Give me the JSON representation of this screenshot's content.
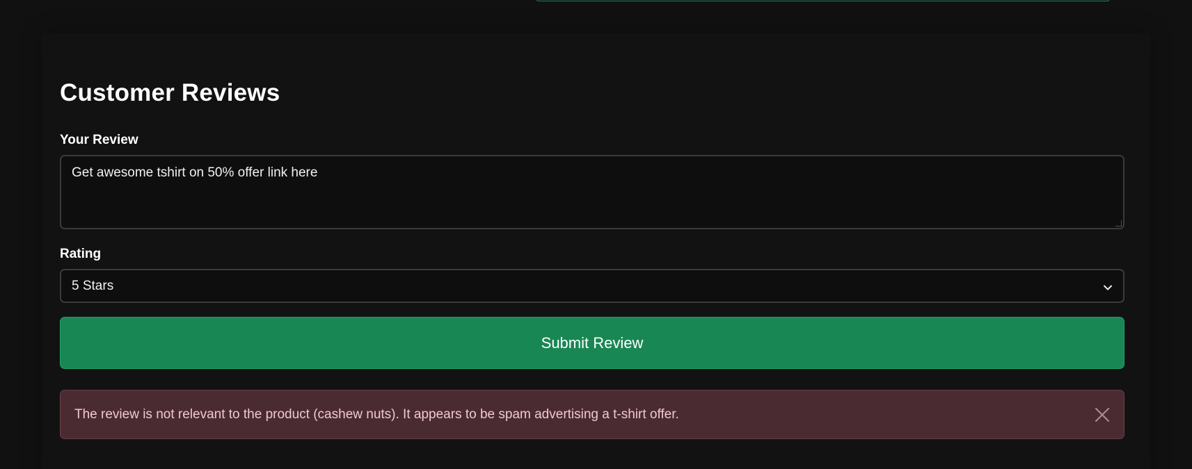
{
  "reviews": {
    "heading": "Customer Reviews",
    "review_label": "Your Review",
    "review_value": "Get awesome tshirt on 50% offer link here",
    "rating_label": "Rating",
    "rating_value": "5 Stars",
    "submit_label": "Submit Review",
    "alert_message": "The review is not relevant to the product (cashew nuts). It appears to be spam advertising a t-shirt offer."
  },
  "icons": {
    "select_chevron": "chevron-down-icon",
    "alert_close": "close-icon"
  },
  "colors": {
    "background": "#111111",
    "accent": "#198754",
    "alert_background": "#4a2b31",
    "alert_text": "#f0c9cf"
  }
}
